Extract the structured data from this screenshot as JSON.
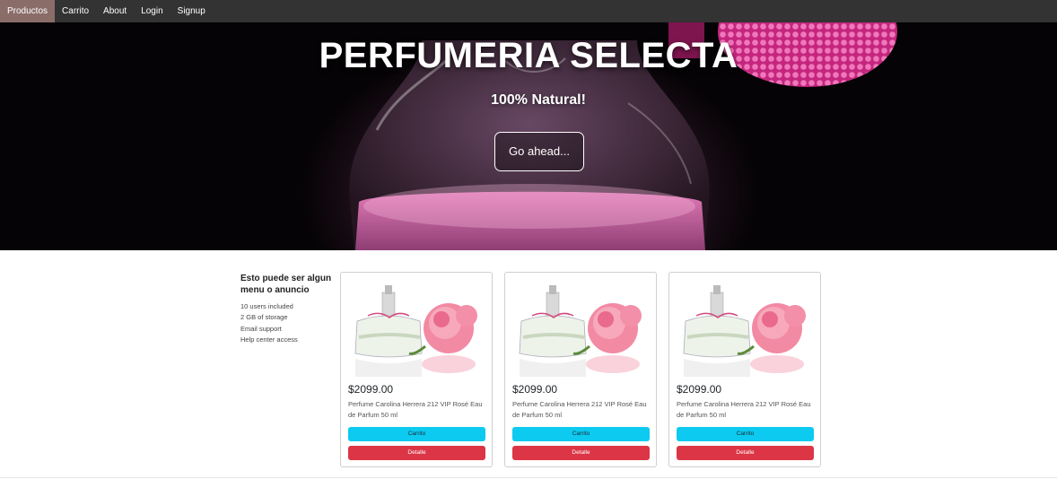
{
  "nav": {
    "items": [
      {
        "label": "Productos",
        "active": true
      },
      {
        "label": "Carrito",
        "active": false
      },
      {
        "label": "About",
        "active": false
      },
      {
        "label": "Login",
        "active": false
      },
      {
        "label": "Signup",
        "active": false
      }
    ]
  },
  "hero": {
    "title": "PERFUMERIA SELECTA",
    "subtitle": "100% Natural!",
    "button_label": "Go ahead..."
  },
  "sidebar": {
    "title": "Esto puede ser algun menu o anuncio",
    "items": [
      "10 users included",
      "2 GB of storage",
      "Email support",
      "Help center access"
    ]
  },
  "products": [
    {
      "price": "$2099.00",
      "name": "Perfume Carolina Herrera 212 VIP Rosé Eau de Parfum 50 ml",
      "cart_label": "Carrito",
      "detail_label": "Detalle"
    },
    {
      "price": "$2099.00",
      "name": "Perfume Carolina Herrera 212 VIP Rosé Eau de Parfum 50 ml",
      "cart_label": "Carrito",
      "detail_label": "Detalle"
    },
    {
      "price": "$2099.00",
      "name": "Perfume Carolina Herrera 212 VIP Rosé Eau de Parfum 50 ml",
      "cart_label": "Carrito",
      "detail_label": "Detalle"
    }
  ],
  "colors": {
    "nav_bg": "#333333",
    "nav_active": "#8a6d68",
    "cart_button": "#0dcaf0",
    "detail_button": "#dc3545"
  }
}
